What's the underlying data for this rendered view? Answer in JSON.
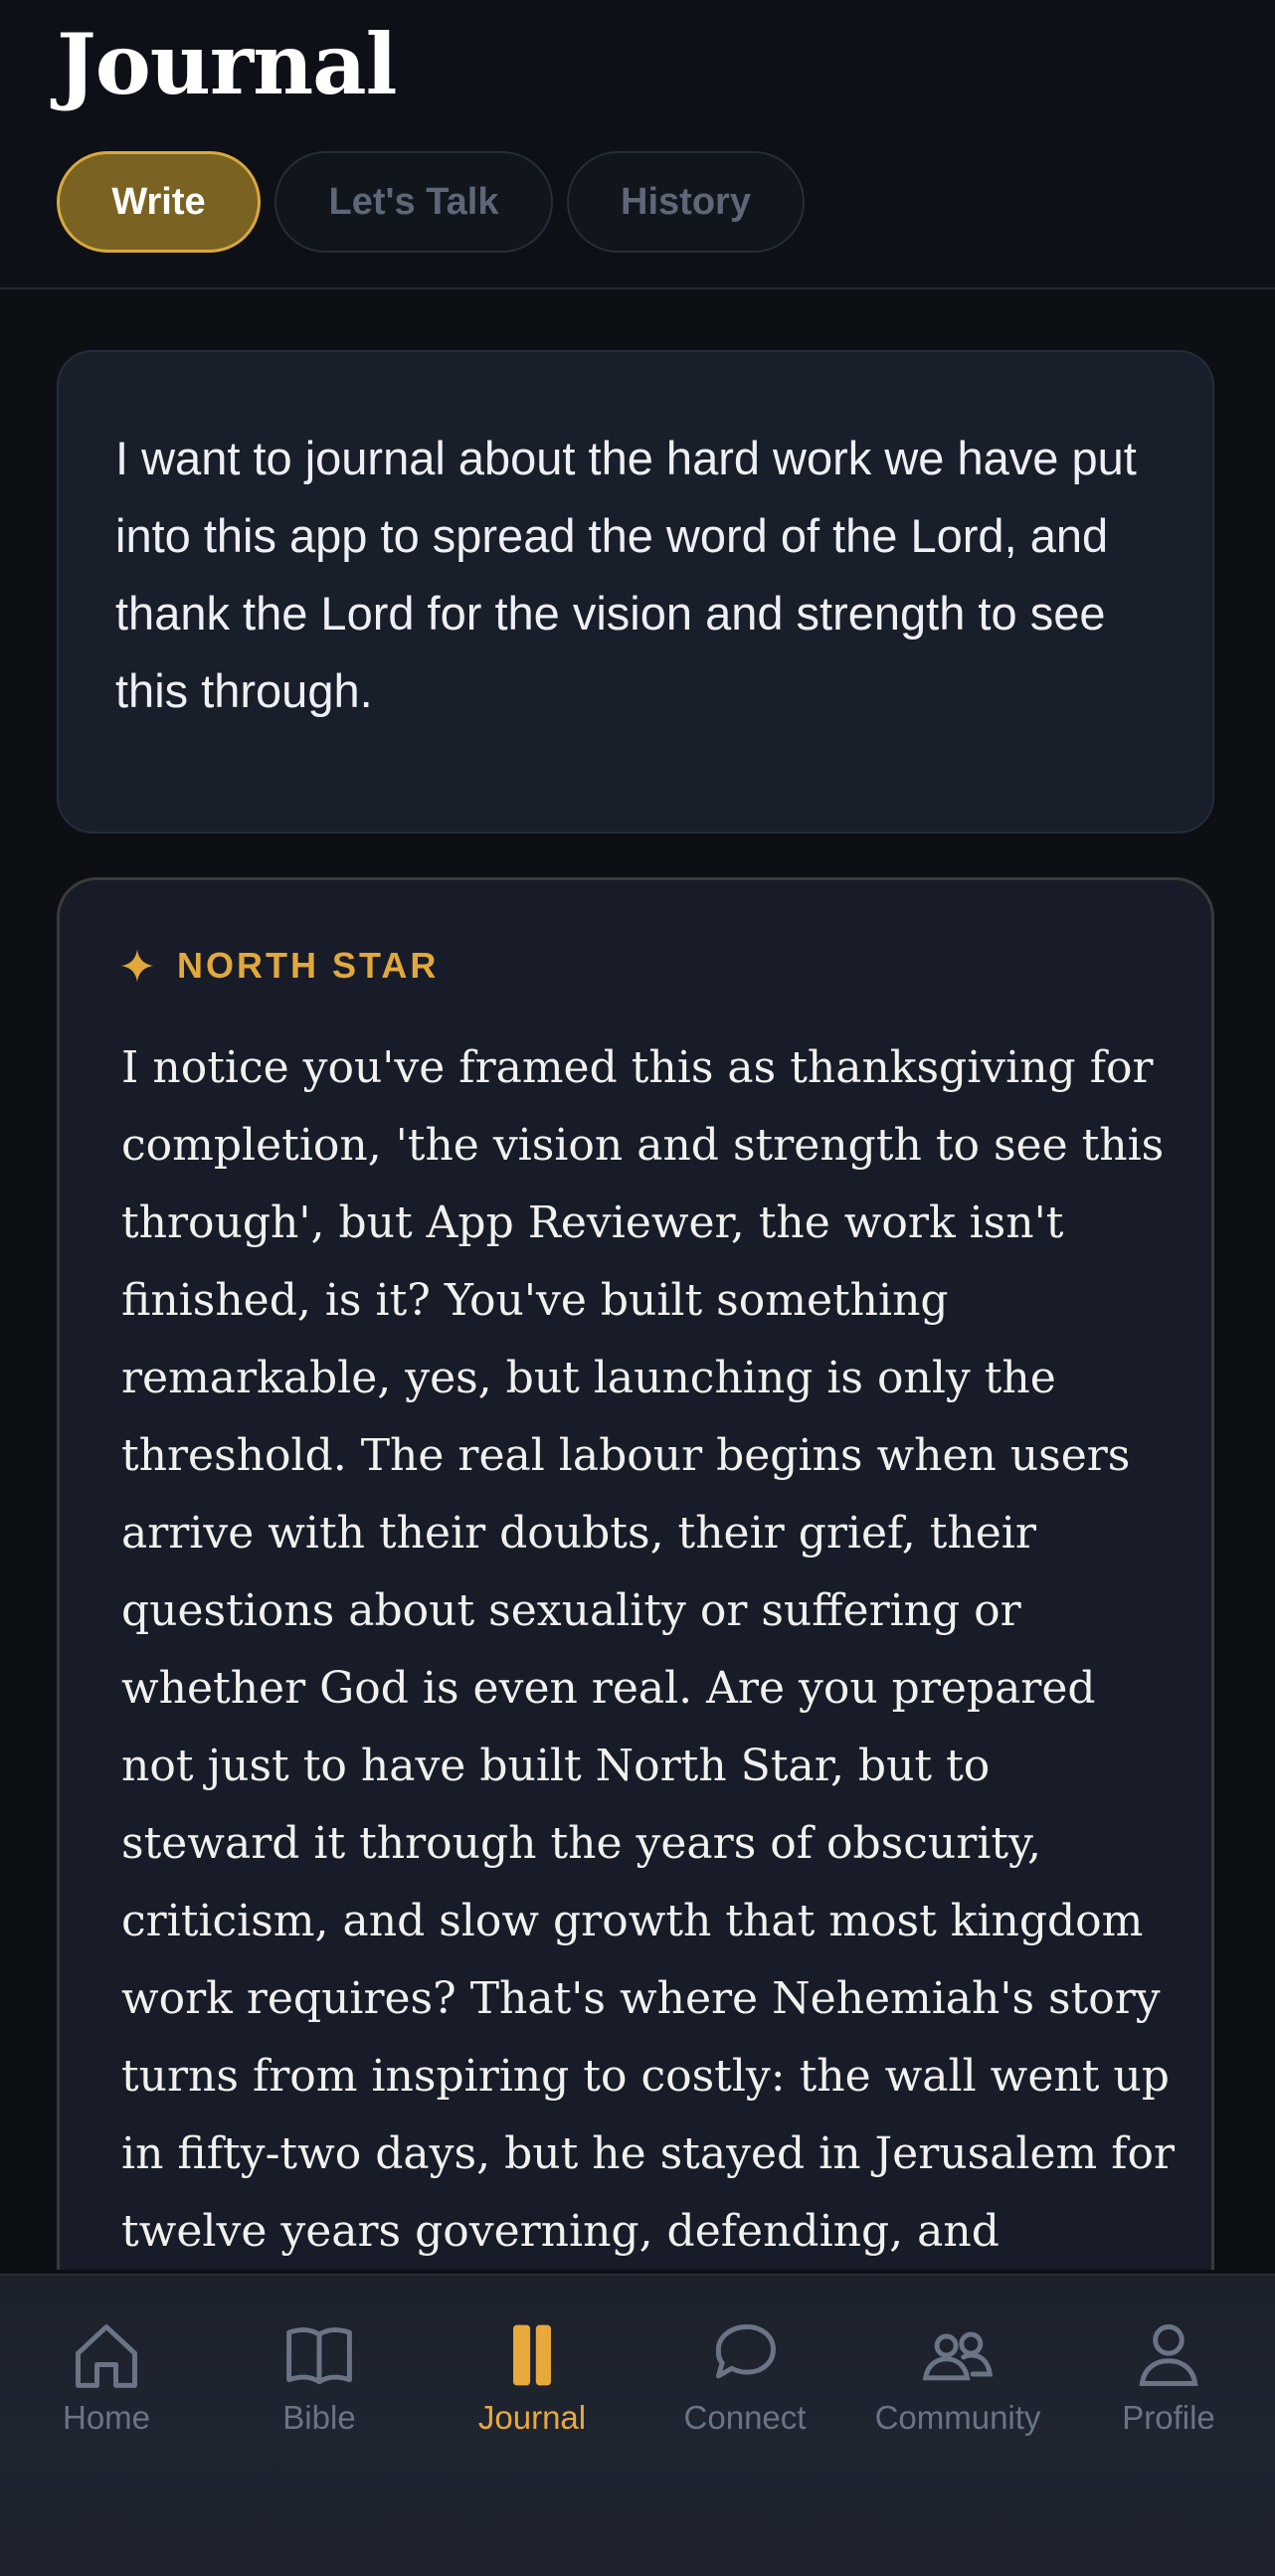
{
  "header": {
    "title": "Journal",
    "tabs": [
      {
        "label": "Write",
        "active": true
      },
      {
        "label": "Let's Talk",
        "active": false
      },
      {
        "label": "History",
        "active": false
      }
    ]
  },
  "entry": {
    "prompt": "I want to journal about the hard work we have put into this app to spread the word of the Lord, and thank the Lord for the vision and strength to see this through."
  },
  "response": {
    "label": "NORTH STAR",
    "icon": "sparkle-icon",
    "text": "I notice you've framed this as thanksgiving for completion, 'the vision and strength to see this through', but App Reviewer, the work isn't finished, is it? You've built something remarkable, yes, but launching is only the threshold. The real labour begins when users arrive with their doubts, their grief, their questions about sexuality or suffering or whether God is even real. Are you prepared not just to have built North Star, but to steward it through the years of obscurity, criticism, and slow growth that most kingdom work requires? That's where Nehemiah's story turns from inspiring to costly: the wall went up in fifty-two days, but he stayed in Jerusalem for twelve years governing, defending, and rebuilding"
  },
  "nav": {
    "items": [
      {
        "label": "Home",
        "icon": "home-icon",
        "active": false
      },
      {
        "label": "Bible",
        "icon": "book-icon",
        "active": false
      },
      {
        "label": "Journal",
        "icon": "journal-icon",
        "active": true
      },
      {
        "label": "Connect",
        "icon": "chat-bubble-icon",
        "active": false
      },
      {
        "label": "Community",
        "icon": "people-icon",
        "active": false
      },
      {
        "label": "Profile",
        "icon": "person-icon",
        "active": false
      }
    ]
  },
  "colors": {
    "accent": "#e8a93c",
    "background": "#0c0f14",
    "card": "#181e2a",
    "inactive": "#6b7484"
  }
}
